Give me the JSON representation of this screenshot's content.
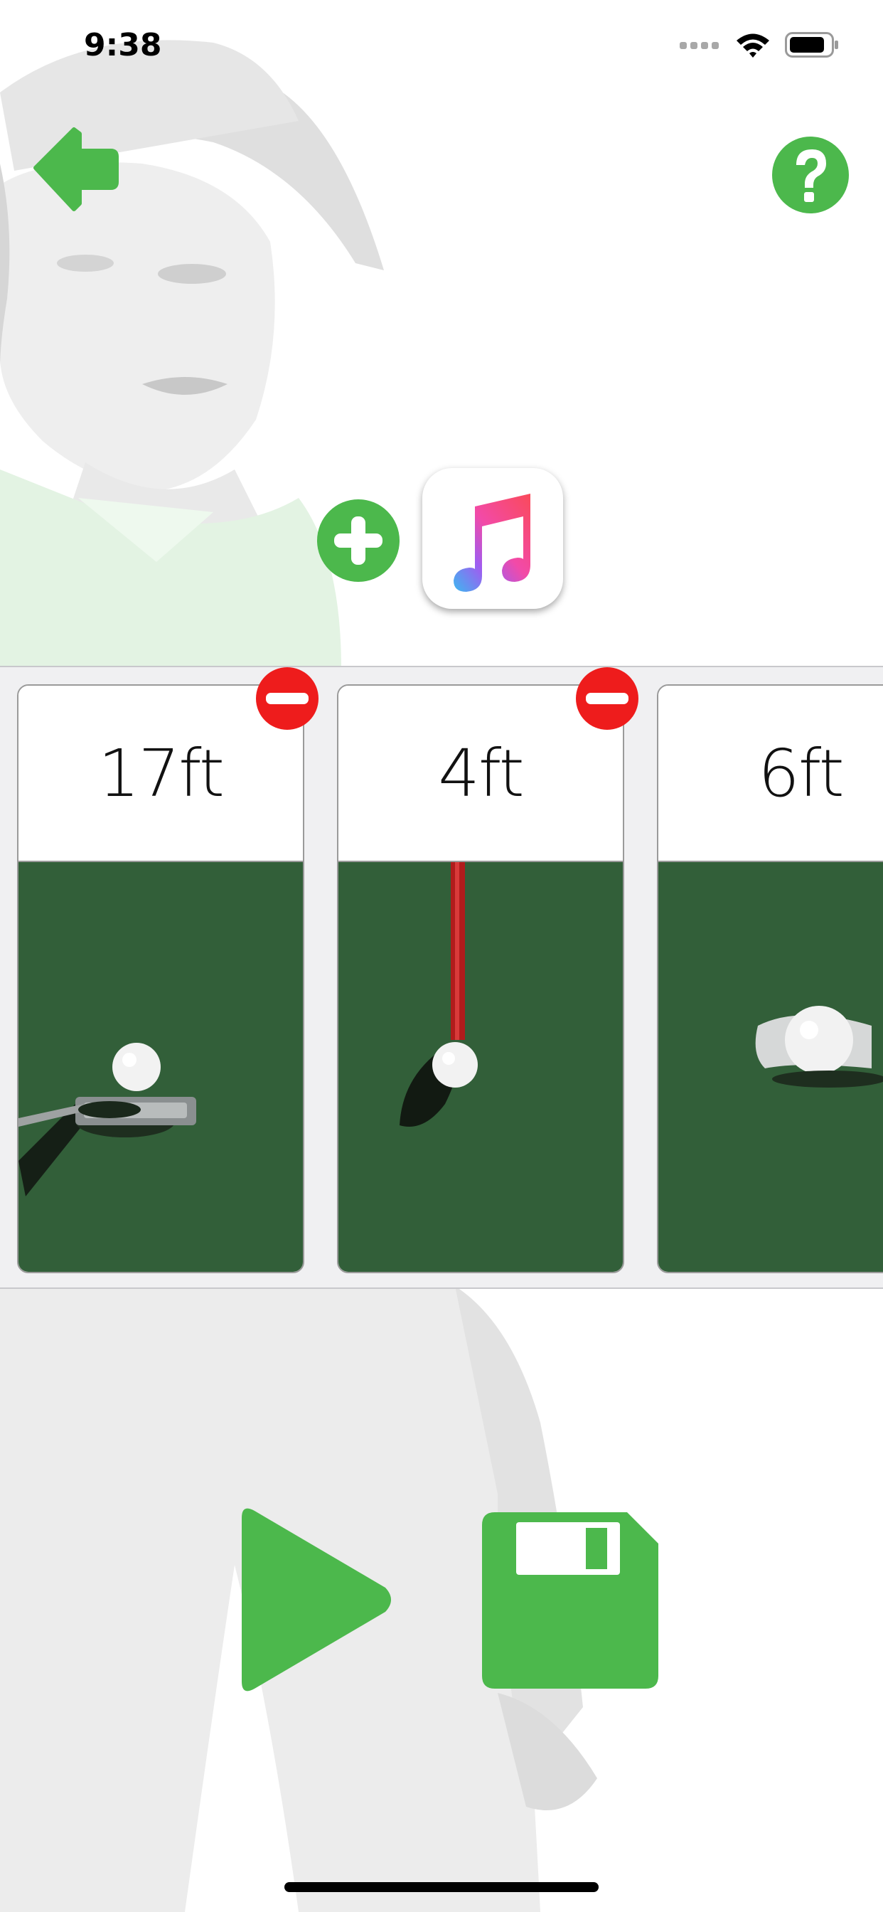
{
  "status_bar": {
    "time": "9:38",
    "icons": [
      "signal-icon",
      "wifi-icon",
      "battery-icon"
    ]
  },
  "nav": {
    "back_icon": "arrow-left-icon",
    "help_icon": "question-circle-icon"
  },
  "music": {
    "add_icon": "plus-circle-icon",
    "app_icon": "music-note-icon"
  },
  "shots": [
    {
      "label": "17ft",
      "removable": true,
      "photo": "putter-ball-green"
    },
    {
      "label": "4ft",
      "removable": true,
      "photo": "ball-flagstick-green"
    },
    {
      "label": "6ft",
      "removable": false,
      "photo": "ball-at-cup-green"
    }
  ],
  "controls": {
    "play_icon": "play-icon",
    "save_icon": "floppy-disk-icon"
  },
  "colors": {
    "accent_green": "#4cb84c",
    "remove_red": "#ee1c1c",
    "grass": "#2f5a36"
  }
}
